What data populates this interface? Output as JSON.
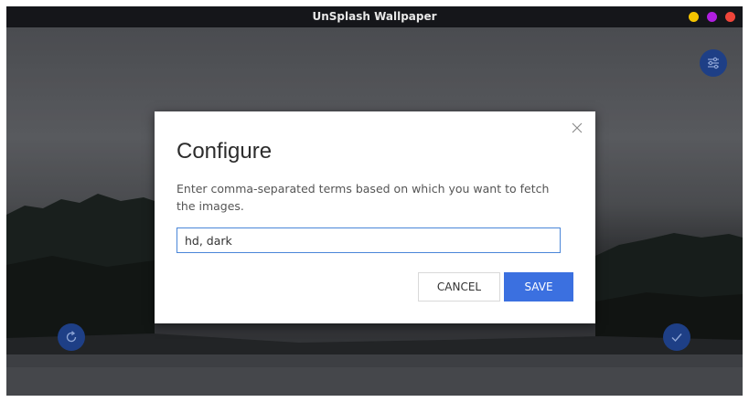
{
  "window": {
    "title": "UnSplash Wallpaper",
    "controls": [
      {
        "name": "minimize",
        "color": "#f5c400"
      },
      {
        "name": "maximize",
        "color": "#b01ee0"
      },
      {
        "name": "close",
        "color": "#f0453a"
      }
    ]
  },
  "background": {
    "settings_icon": "sliders-icon",
    "refresh_icon": "refresh-icon",
    "apply_icon": "check-icon"
  },
  "dialog": {
    "title": "Configure",
    "description": "Enter comma-separated terms based on which you want to fetch the images.",
    "input_value": "hd, dark",
    "cancel_label": "CANCEL",
    "save_label": "SAVE",
    "close_icon": "close-icon"
  },
  "colors": {
    "accent": "#3b70e0",
    "fab": "#1e3f86"
  }
}
